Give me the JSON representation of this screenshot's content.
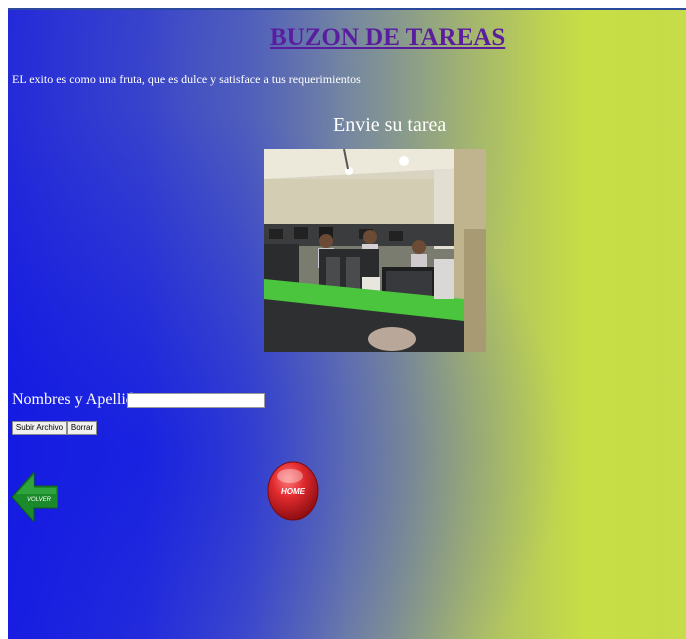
{
  "header": {
    "title": "BUZON DE TAREAS",
    "quote": "EL exito es como una fruta, que  es dulce  y  satisface  a  tus requerimientos"
  },
  "main": {
    "subtitle": "Envie su tarea",
    "photo_icon": "classroom-photo"
  },
  "form": {
    "name_label": "Nombres y Apellido:",
    "name_value": "",
    "upload_button": "Subir Archivo",
    "reset_button": "Borrar"
  },
  "nav": {
    "back_label": "VOLVER",
    "back_icon": "left-arrow-icon",
    "home_label": "HOME",
    "home_icon": "red-sphere-icon"
  },
  "colors": {
    "title": "#5a1d9e",
    "gradient_left": "#1b1fe0",
    "gradient_right": "#c8de45",
    "back_arrow": "#1a8a2a",
    "home_button": "#d81e24"
  }
}
